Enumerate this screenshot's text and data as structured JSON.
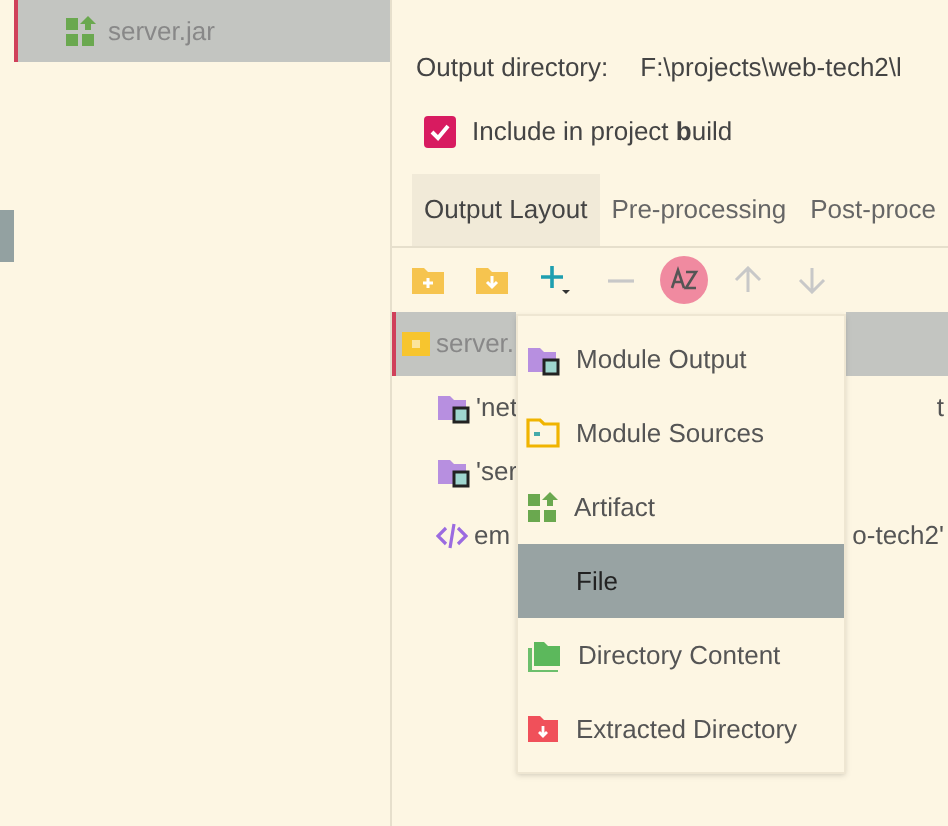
{
  "artifacts": [
    {
      "label": "server.jar",
      "selected": true
    }
  ],
  "output_directory": {
    "label": "Output directory:",
    "value": "F:\\projects\\web-tech2\\l"
  },
  "include_in_build": {
    "label": "Include in project **b**uild",
    "checked": true
  },
  "tabs": [
    {
      "label": "Output Layout",
      "selected": true
    },
    {
      "label": "Pre-processing",
      "selected": false
    },
    {
      "label": "Post-proce",
      "selected": false
    }
  ],
  "toolbar": [
    {
      "kind": "folder-add"
    },
    {
      "kind": "folder-down"
    },
    {
      "kind": "add"
    },
    {
      "kind": "remove"
    },
    {
      "kind": "sort",
      "selected": true
    },
    {
      "kind": "up"
    },
    {
      "kind": "down"
    }
  ],
  "tree": [
    {
      "kind": "jar",
      "label": "server.",
      "selected": true
    },
    {
      "kind": "module",
      "label": "'net",
      "tail": "t",
      "selected": false
    },
    {
      "kind": "module",
      "label": "'ser",
      "selected": false
    },
    {
      "kind": "xml",
      "label": "em",
      "tail": "o-tech2'",
      "selected": false
    }
  ],
  "menu": [
    {
      "kind": "module",
      "label": "Module Output",
      "selected": false
    },
    {
      "kind": "sources",
      "label": "Module Sources",
      "selected": false
    },
    {
      "kind": "artifact",
      "label": "Artifact",
      "selected": false
    },
    {
      "kind": "file",
      "label": "File",
      "selected": true
    },
    {
      "kind": "dir",
      "label": "Directory Content",
      "selected": false
    },
    {
      "kind": "extract",
      "label": "Extracted Directory",
      "selected": false
    }
  ]
}
